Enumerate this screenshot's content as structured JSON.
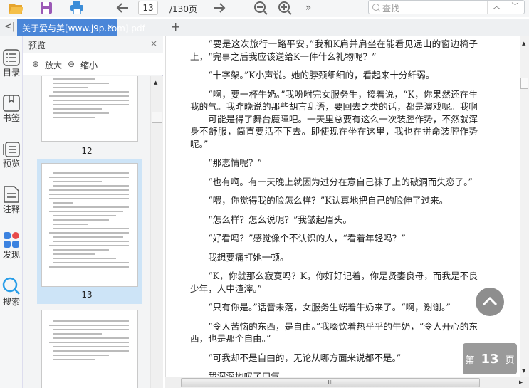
{
  "toolbar": {
    "current_page": "13",
    "page_total": "/130页",
    "search_placeholder": "查找",
    "icons": [
      "folder-open-icon",
      "save-icon",
      "print-icon",
      "arrow-left-icon",
      "arrow-right-icon",
      "zoom-out-icon",
      "zoom-in-icon",
      "more-icon",
      "chevron-up-icon",
      "chevron-down-icon"
    ]
  },
  "tabs": {
    "collapse": "<|",
    "active": "关于爱与美[www.j9p.com].pdf",
    "close": "×",
    "add": "+"
  },
  "rail": [
    {
      "label": "目录"
    },
    {
      "label": "书签"
    },
    {
      "label": "预览"
    },
    {
      "label": "注释"
    },
    {
      "label": "发现"
    },
    {
      "label": "搜索"
    }
  ],
  "panel": {
    "title": "预览",
    "close": "×",
    "zoom_in": "放大",
    "zoom_out": "缩小",
    "thumbs": [
      {
        "label": "12"
      },
      {
        "label": "13"
      }
    ]
  },
  "document": {
    "paragraphs": [
      "“要是这次旅行一路平安，”我和K肩并肩坐在能看见远山的窗边椅子上，“完事之后我应该送给K一件什么礼物呢？”",
      "“十字架。”K小声说。她的脖颈细细的，看起来十分纤弱。",
      "“啊，要一杯牛奶。”我吩咐完女服务生，接着说，“K，你果然还在生我的气。我昨晚说的那些胡言乱语，要回去之类的话，都是演戏呢。我啊——可能是得了舞台魔障吧。一天里总要有这么一次装腔作势，不然就浑身不舒服，简直要活不下去。即使现在坐在这里，我也在拼命装腔作势呢。”",
      "“那恋情呢？”",
      "“也有啊。有一天晚上就因为过分在意自己袜子上的破洞而失恋了。”",
      "“喂，你觉得我的脸怎么样？”K认真地把自己的脸伸了过来。",
      "“怎么样？怎么说呢？”我皱起眉头。",
      "“好看吗？”感觉像个不认识的人，“看着年轻吗？”",
      "我想要痛打她一顿。",
      "“K，你就那么寂寞吗？K，你好好记着，你是贤妻良母，而我是不良少年，人中渣滓。”",
      "“只有你是。”话音未落，女服务生端着牛奶来了。“啊，谢谢。”",
      "“令人苦恼的东西，是自由。”我啜饮着热乎乎的牛奶，“令人开心的东西，也是那个自由。”",
      "“可我却不是自由的，无论从哪方面来说都不是。”",
      "我深深地叹了口气。"
    ]
  },
  "page_badge": {
    "prefix": "第",
    "number": "13",
    "suffix": "页"
  },
  "colors": {
    "accent": "#4a86d8",
    "selected_thumb": "#cde4f7",
    "badge": "#9a9a9a"
  }
}
